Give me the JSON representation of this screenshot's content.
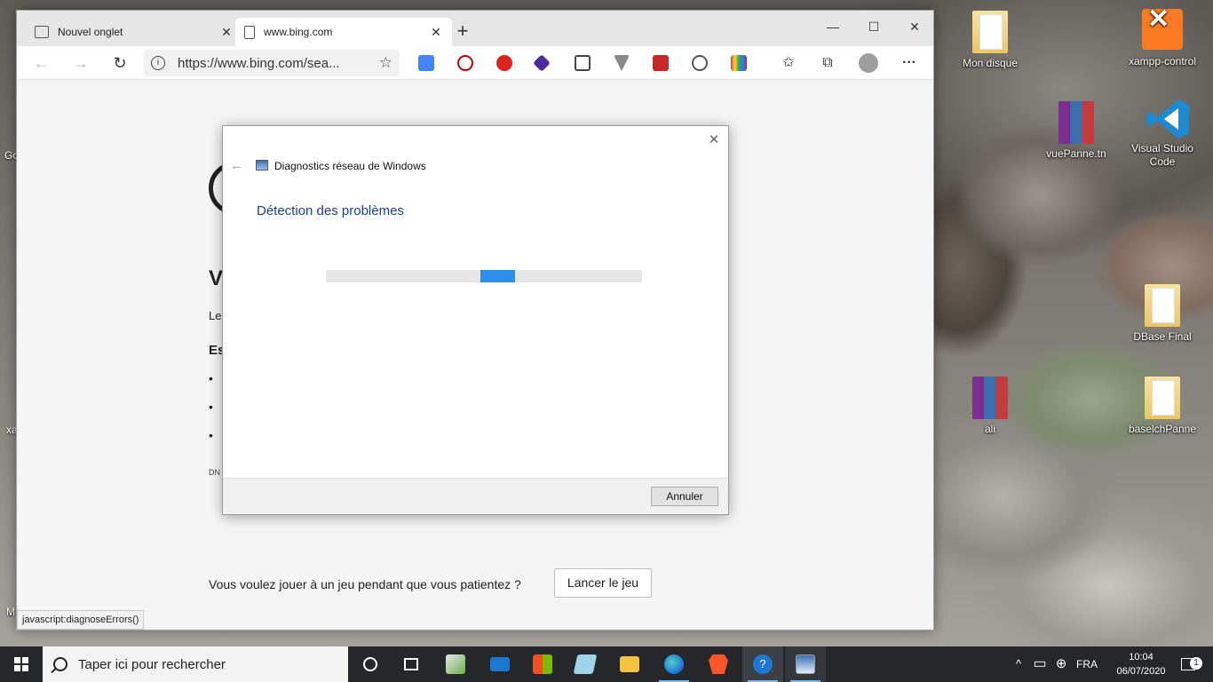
{
  "desktop": {
    "icons": [
      {
        "label": "Mon disque"
      },
      {
        "label": "xampp-control"
      },
      {
        "label": "vuePanne.tn"
      },
      {
        "label": "Visual Studio Code"
      },
      {
        "label": "DBase Final"
      },
      {
        "label": "ali"
      },
      {
        "label": "baselchPanne"
      }
    ],
    "partial_left_labels": [
      "Go",
      "xa",
      "M"
    ]
  },
  "browser": {
    "tabs": [
      {
        "title": "Nouvel onglet",
        "close": "✕"
      },
      {
        "title": "www.bing.com",
        "close": "✕"
      }
    ],
    "new_tab": "+",
    "window_controls": {
      "minimize": "—",
      "maximize": "☐",
      "close": "✕"
    },
    "nav": {
      "back": "←",
      "forward": "→",
      "refresh": "↻"
    },
    "address": {
      "url": "https://www.bing.com/sea...",
      "info": "i",
      "favorite": "☆"
    },
    "toolbar_icons": {
      "favorites": "✩",
      "collections": "⧉",
      "more": "···"
    },
    "page": {
      "heading": "V",
      "line1": "Le",
      "subheading": "Es",
      "bullets": [
        "•",
        "•",
        "•"
      ],
      "dns_code": "DN",
      "game_prompt": "Vous voulez jouer à un jeu pendant que vous patientez ?",
      "game_button": "Lancer le jeu"
    },
    "status_url": "javascript:diagnoseErrors()"
  },
  "dialog": {
    "title": "Diagnostics réseau de Windows",
    "heading": "Détection des problèmes",
    "progress_indeterminate_position": 0.49,
    "cancel_label": "Annuler",
    "close": "✕",
    "back": "←"
  },
  "taskbar": {
    "search_placeholder": "Taper ici pour rechercher",
    "language": "FRA",
    "time": "10:04",
    "date": "06/07/2020",
    "notification_count": "1"
  },
  "colors": {
    "dialog_heading": "#1c3f95",
    "progress": "#2f8ee8",
    "taskbar": "#25272a"
  }
}
